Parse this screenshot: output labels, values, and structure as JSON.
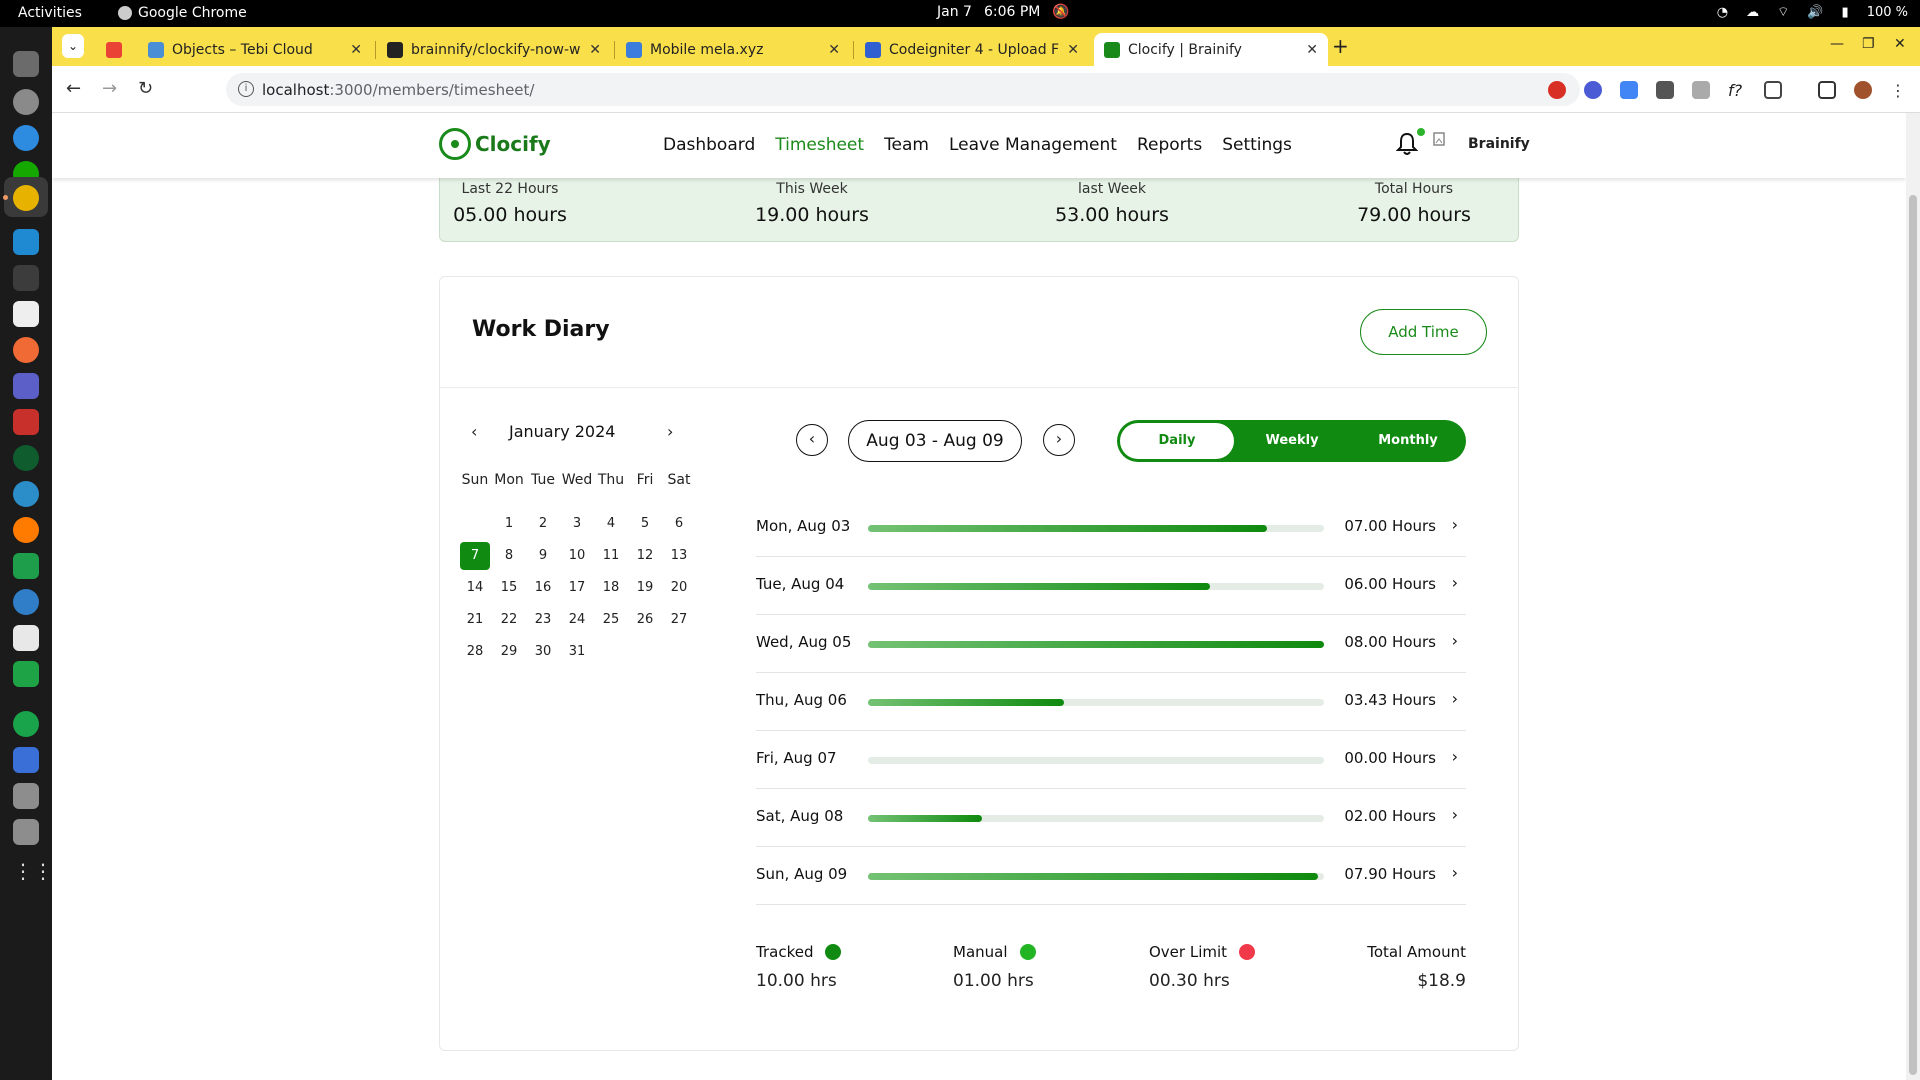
{
  "system": {
    "activities": "Activities",
    "app_name": "Google Chrome",
    "date": "Jan 7",
    "time": "6:06 PM",
    "battery": "100 %"
  },
  "browser": {
    "tabs": [
      {
        "title": "Objects – Tebi Cloud",
        "favicon_color": "#4a8fd6"
      },
      {
        "title": "brainnify/clockify-now-w",
        "favicon_color": "#222222"
      },
      {
        "title": "Mobile mela.xyz",
        "favicon_color": "#3b7ddd"
      },
      {
        "title": "Codeigniter 4 - Upload Fi",
        "favicon_color": "#2f5fd0"
      },
      {
        "title": "Clocify | Brainify",
        "favicon_color": "#1a8a1a"
      }
    ],
    "url_host": "localhost",
    "url_path": ":3000/members/timesheet/"
  },
  "app": {
    "brand": "Clocify",
    "nav": [
      "Dashboard",
      "Timesheet",
      "Team",
      "Leave Management",
      "Reports",
      "Settings"
    ],
    "active_nav": "Timesheet",
    "user": "Brainify",
    "accent": "#118a11"
  },
  "stats": [
    {
      "label": "Last 22 Hours",
      "value": "05.00 hours"
    },
    {
      "label": "This Week",
      "value": "19.00 hours"
    },
    {
      "label": "last Week",
      "value": "53.00 hours"
    },
    {
      "label": "Total Hours",
      "value": "79.00 hours"
    }
  ],
  "diary": {
    "title": "Work Diary",
    "add_label": "Add Time",
    "calendar": {
      "month": "January 2024",
      "dow": [
        "Sun",
        "Mon",
        "Tue",
        "Wed",
        "Thu",
        "Fri",
        "Sat"
      ],
      "selected": 7,
      "first_weekday": 1,
      "days_in_month": 31
    },
    "range": "Aug 03 - Aug 09",
    "views": [
      "Daily",
      "Weekly",
      "Monthly"
    ],
    "active_view": "Daily",
    "days": [
      {
        "label": "Mon, Aug 03",
        "hours": "07.00 Hours",
        "fraction": 0.875
      },
      {
        "label": "Tue, Aug 04",
        "hours": "06.00 Hours",
        "fraction": 0.75
      },
      {
        "label": "Wed, Aug 05",
        "hours": "08.00 Hours",
        "fraction": 1.0
      },
      {
        "label": "Thu, Aug 06",
        "hours": "03.43 Hours",
        "fraction": 0.43
      },
      {
        "label": "Fri, Aug 07",
        "hours": "00.00 Hours",
        "fraction": 0.0
      },
      {
        "label": "Sat, Aug 08",
        "hours": "02.00 Hours",
        "fraction": 0.25
      },
      {
        "label": "Sun, Aug 09",
        "hours": "07.90 Hours",
        "fraction": 0.9875
      }
    ],
    "legend": [
      {
        "name": "Tracked",
        "value": "10.00 hrs",
        "color": "#118a11"
      },
      {
        "name": "Manual",
        "value": "01.00 hrs",
        "color": "#22b422"
      },
      {
        "name": "Over Limit",
        "value": "00.30 hrs",
        "color": "#f03a4a"
      },
      {
        "name": "Total Amount",
        "value": "$18.9",
        "color": ""
      }
    ]
  }
}
